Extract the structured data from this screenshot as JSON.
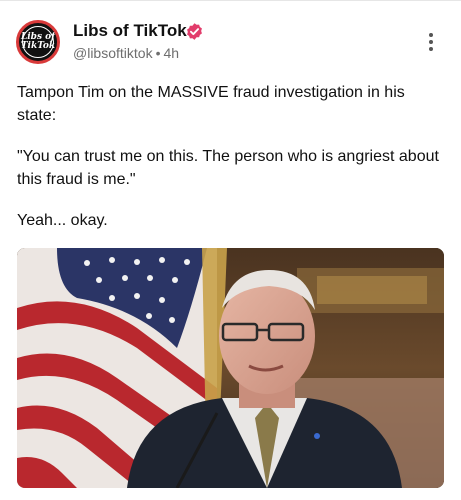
{
  "author": {
    "display_name": "Libs of TikTok",
    "handle": "@libsoftiktok",
    "time_ago": "4h",
    "avatar_text_line1": "Libs of",
    "avatar_text_line2": "TikTok"
  },
  "post": {
    "paragraphs": [
      "Tampon Tim on the MASSIVE fraud investigation in his state:",
      "\"You can trust me on this. The person who is angriest about this fraud is me.\"",
      "Yeah... okay."
    ]
  },
  "colors": {
    "verified_badge": "#e23c6b",
    "avatar_ring": "#d93a3a",
    "meta_text": "#6e6e6e"
  },
  "icons": {
    "verified": "verified-badge-icon",
    "menu": "more-vertical-icon"
  }
}
